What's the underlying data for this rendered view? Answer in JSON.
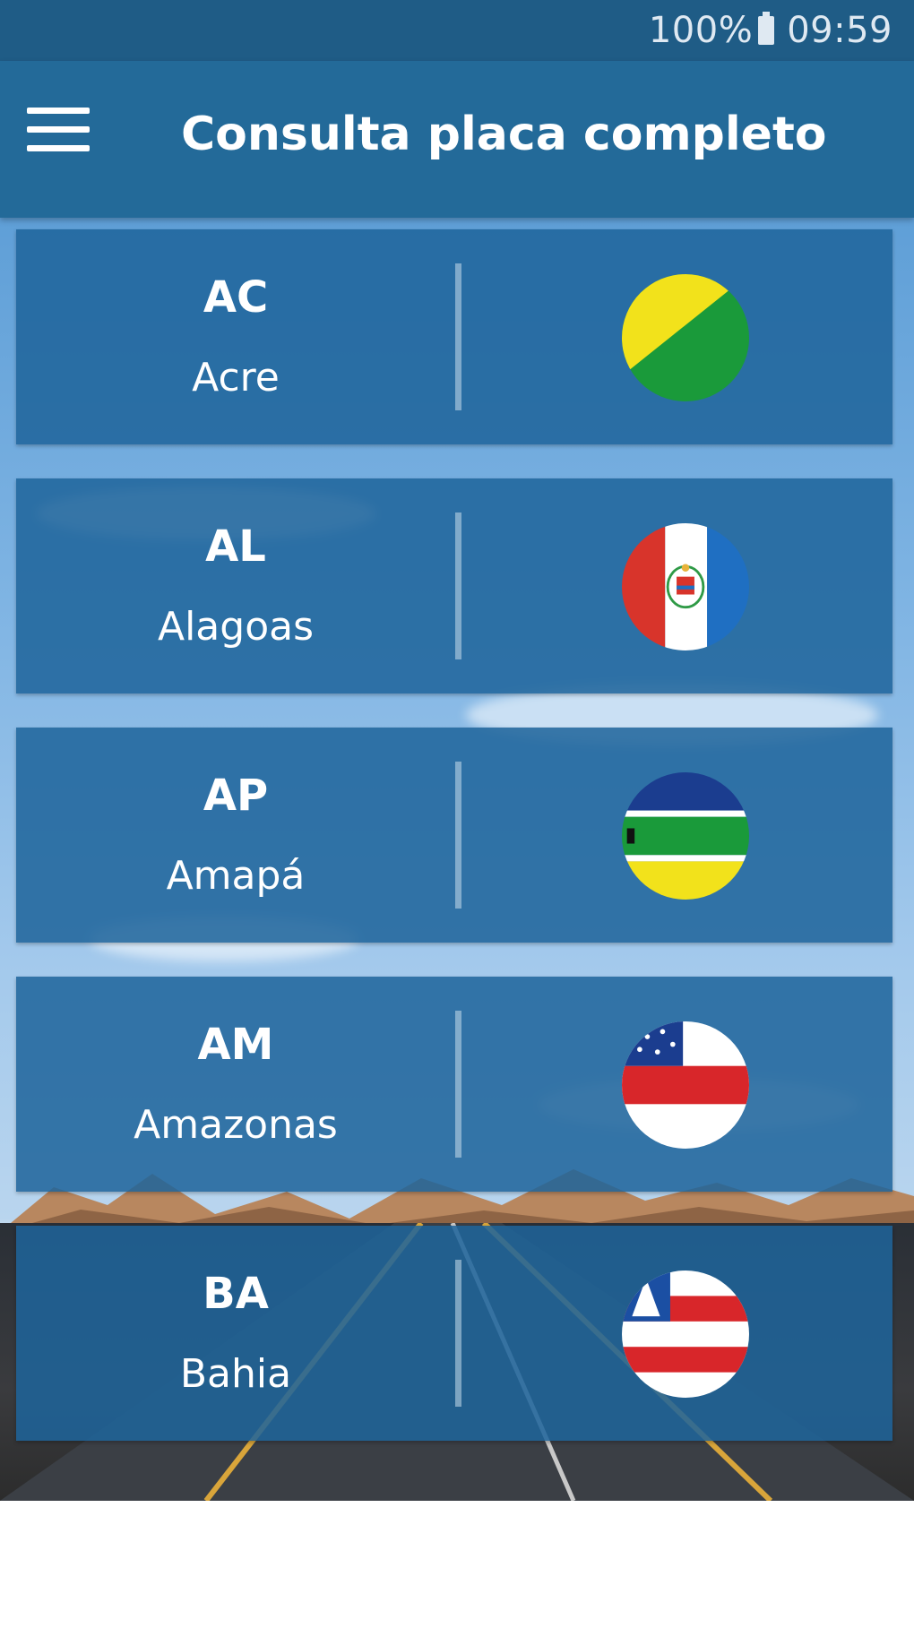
{
  "status_bar": {
    "battery": "100%",
    "time": "09:59"
  },
  "app_bar": {
    "title": "Consulta placa completo",
    "menu_icon": "hamburger-menu-icon"
  },
  "states": [
    {
      "code": "AC",
      "name": "Acre",
      "flag_icon": "acre-flag-icon"
    },
    {
      "code": "AL",
      "name": "Alagoas",
      "flag_icon": "alagoas-flag-icon"
    },
    {
      "code": "AP",
      "name": "Amapá",
      "flag_icon": "amapa-flag-icon"
    },
    {
      "code": "AM",
      "name": "Amazonas",
      "flag_icon": "amazonas-flag-icon"
    },
    {
      "code": "BA",
      "name": "Bahia",
      "flag_icon": "bahia-flag-icon"
    }
  ],
  "colors": {
    "app_bar": "#236a99",
    "status_bar": "#1f5c86",
    "card": "#1e649b"
  }
}
